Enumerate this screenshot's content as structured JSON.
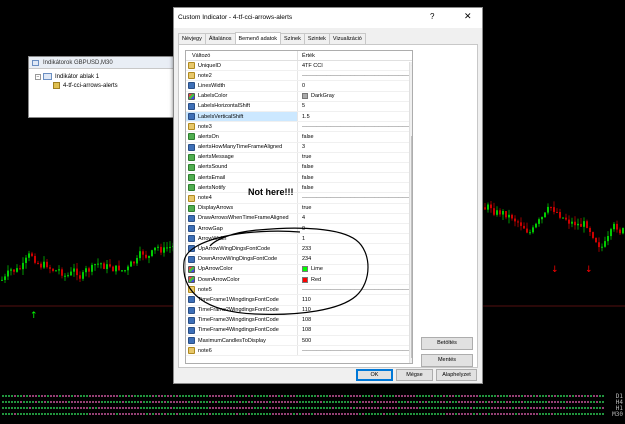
{
  "navigator": {
    "title": "Indikátorok GBPUSD,M30",
    "folder": "Indikátor ablak 1",
    "item": "4-tf-cci-arrows-alerts"
  },
  "dialog": {
    "title": "Custom Indicator - 4-tf-cci-arrows-alerts",
    "help": "?",
    "close": "✕",
    "tabs": [
      "Névjegy",
      "Általános",
      "Bemenő adatok",
      "Színek",
      "Szintek",
      "Vizualizáció"
    ],
    "active_tab": "Bemenő adatok",
    "grid_headers": {
      "name": "Változó",
      "value": "Érték"
    },
    "side_buttons": {
      "load": "Betöltés",
      "save": "Mentés"
    },
    "buttons": {
      "ok": "OK",
      "cancel": "Mégse",
      "reset": "Alaphelyzet"
    }
  },
  "annotation": "Not here!!!",
  "params": [
    {
      "icon": "ab",
      "name": "UniqueID",
      "value": "4TF CCI"
    },
    {
      "icon": "ab",
      "name": "note2",
      "value": "",
      "dashes": true
    },
    {
      "icon": "num",
      "name": "LinesWidth",
      "value": "0"
    },
    {
      "icon": "color",
      "name": "LabelsColor",
      "value": "DarkGray",
      "swatch": "#a9a9a9"
    },
    {
      "icon": "num",
      "name": "LabelsHorizontalShift",
      "value": "5"
    },
    {
      "icon": "num",
      "name": "LabelsVerticalShift",
      "value": "1.5",
      "selected": true
    },
    {
      "icon": "ab",
      "name": "note3",
      "value": "",
      "dashes": true
    },
    {
      "icon": "bool",
      "name": "alertsOn",
      "value": "false"
    },
    {
      "icon": "num",
      "name": "alertsHowManyTimeFrameAligned",
      "value": "3"
    },
    {
      "icon": "bool",
      "name": "alertsMessage",
      "value": "true"
    },
    {
      "icon": "bool",
      "name": "alertsSound",
      "value": "false"
    },
    {
      "icon": "bool",
      "name": "alertsEmail",
      "value": "false"
    },
    {
      "icon": "bool",
      "name": "alertsNotify",
      "value": "false"
    },
    {
      "icon": "ab",
      "name": "note4",
      "value": "",
      "dashes": true
    },
    {
      "icon": "bool",
      "name": "DisplayArrows",
      "value": "true"
    },
    {
      "icon": "num",
      "name": "DrawArrowsWhenTimeFrameAligned",
      "value": "4"
    },
    {
      "icon": "num",
      "name": "ArrowGap",
      "value": "0"
    },
    {
      "icon": "num",
      "name": "ArrowWidth",
      "value": "1"
    },
    {
      "icon": "num",
      "name": "UpArrowWingDingsFontCode",
      "value": "233"
    },
    {
      "icon": "num",
      "name": "DownArrowWingDingsFontCode",
      "value": "234"
    },
    {
      "icon": "color",
      "name": "UpArrowColor",
      "value": "Lime",
      "swatch": "#00ff00"
    },
    {
      "icon": "color",
      "name": "DownArrowColor",
      "value": "Red",
      "swatch": "#ff0000"
    },
    {
      "icon": "ab",
      "name": "note5",
      "value": "",
      "dashes": true
    },
    {
      "icon": "num",
      "name": "TimeFrame1WingdingsFontCode",
      "value": "110"
    },
    {
      "icon": "num",
      "name": "TimeFrame2WingdingsFontCode",
      "value": "110"
    },
    {
      "icon": "num",
      "name": "TimeFrame3WingdingsFontCode",
      "value": "108"
    },
    {
      "icon": "num",
      "name": "TimeFrame4WingdingsFontCode",
      "value": "108"
    },
    {
      "icon": "num",
      "name": "MaximumCandlesToDisplay",
      "value": "500"
    },
    {
      "icon": "ab",
      "name": "note6",
      "value": "",
      "dashes": true
    }
  ],
  "indicator_labels": [
    "D1",
    "H4",
    "H1",
    "M30"
  ],
  "colors": {
    "bull": "#00ff00",
    "bear": "#ff0000",
    "dot_pink": "#ff6ec7",
    "dot_green": "#39ff6a"
  }
}
